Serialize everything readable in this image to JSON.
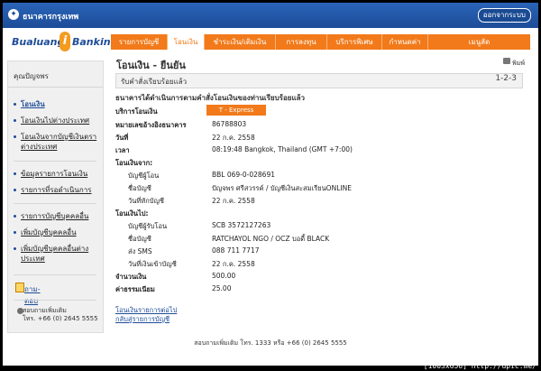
{
  "topbar": {
    "bank_name": "ธนาคารกรุงเทพ",
    "logout": "ออกจากระบบ"
  },
  "brand": {
    "part1": "Bualuang",
    "part2": "i",
    "part3": "Banking"
  },
  "nav": [
    {
      "label": "รายการบัญชี"
    },
    {
      "label": "โอนเงิน"
    },
    {
      "label": "ชำระเงิน/เติมเงิน"
    },
    {
      "label": "การลงทุน"
    },
    {
      "label": "บริการพิเศษ"
    },
    {
      "label": "กำหนดค่า"
    },
    {
      "label": "เมนูลัด"
    }
  ],
  "sidebar": {
    "header": "คุณปัญจพร",
    "items": [
      {
        "label": "โอนเงิน"
      },
      {
        "label": "โอนเงินไปต่างประเทศ"
      },
      {
        "label": "โอนเงินจากบัญชีเงินตราต่างประเทศ"
      },
      {
        "label": "ข้อมูลรายการโอนเงิน"
      },
      {
        "label": "รายการที่รอดำเนินการ"
      },
      {
        "label": "รายการบัญชีบุคคลอื่น"
      },
      {
        "label": "เพิ่มบัญชีบุคคลอื่น"
      },
      {
        "label": "เพิ่มบัญชีบุคคลอื่นต่างประเทศ"
      }
    ],
    "help": "ถาม-ตอบ",
    "contact_line1": "สอบถามเพิ่มเติม",
    "contact_line2": "โทร. +66 (0) 2645 5555"
  },
  "content": {
    "title": "โอนเงิน - ยืนยัน",
    "print": "พิมพ์",
    "status": "รับคำสั่งเรียบร้อยแล้ว",
    "step": "1-2-3",
    "message": "ธนาคารได้ดำเนินการตามคำสั่งโอนเงินของท่านเรียบร้อยแล้ว",
    "service_label": "บริการโอนเงิน",
    "service_badge": "T - Express",
    "ref_label": "หมายเลขอ้างอิงธนาคาร",
    "ref_value": "86788803",
    "date_label": "วันที่",
    "date_value": "22 ก.ค. 2558",
    "time_label": "เวลา",
    "time_value": "08:19:48 Bangkok, Thailand (GMT +7:00)",
    "from_label": "โอนเงินจาก:",
    "from_acct_label": "บัญชีผู้โอน",
    "from_acct_value": "BBL 069-0-028691",
    "from_name_label": "ชื่อบัญชี",
    "from_name_value": "ปัญจพร ศรีสวรรค์ / บัญชีเงินสะสมเรียนONLINE",
    "from_date_label": "วันที่หักบัญชี",
    "from_date_value": "22 ก.ค. 2558",
    "to_label": "โอนเงินไป:",
    "to_acct_label": "บัญชีผู้รับโอน",
    "to_acct_value": "SCB 3572127263",
    "to_name_label": "ชื่อบัญชี",
    "to_name_value": "RATCHAYOL NGO / OCZ บอดี้ BLACK",
    "sms_label": "ส่ง SMS",
    "sms_value": "088 711 7717",
    "to_date_label": "วันที่เงินเข้าบัญชี",
    "to_date_value": "22 ก.ค. 2558",
    "amount_label": "จำนวนเงิน",
    "amount_value": "500.00",
    "fee_label": "ค่าธรรมเนียม",
    "fee_value": "25.00",
    "link1": "โอนเงินรายการต่อไป",
    "link2": "กลับสู่รายการบัญชี"
  },
  "footer": "สอบถามเพิ่มเติม โทร. 1333 หรือ +66 (0) 2645 5555",
  "watermark": "[1003x656] http://upic.me/"
}
